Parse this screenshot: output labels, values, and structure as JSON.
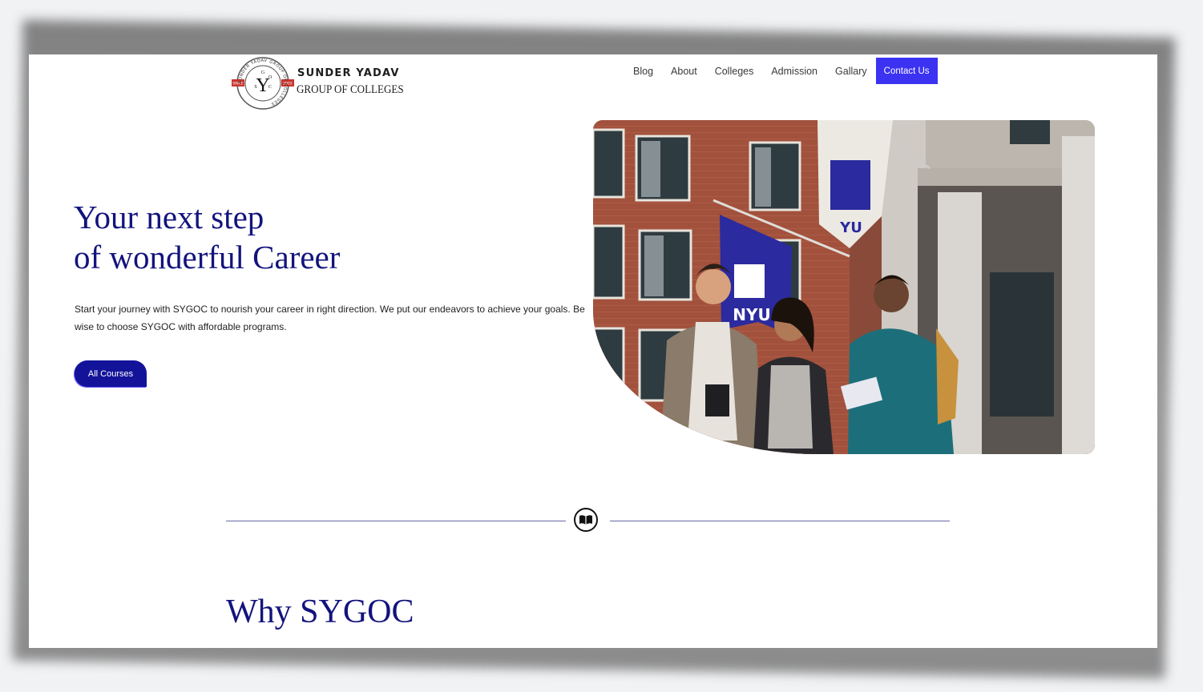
{
  "brand": {
    "logo_ring_text": "SUNDER YADAV GROUP OF COLLEGES",
    "logo_initials": "Y",
    "logo_letters": [
      "S",
      "G",
      "O",
      "C"
    ],
    "logo_since": "SINCE",
    "logo_year": "2002",
    "name": "SUNDER YADAV",
    "subtitle": "GROUP OF COLLEGES"
  },
  "nav": {
    "items": [
      "Blog",
      "About",
      "Colleges",
      "Admission",
      "Gallary"
    ],
    "cta": "Contact Us"
  },
  "hero": {
    "title_line1": "Your next step",
    "title_line2": "of wonderful Career",
    "text": "Start your journey with SYGOC to nourish your career in right direction. We put our endeavors to achieve your goals. Be wise to choose SYGOC with affordable programs.",
    "button": "All Courses",
    "image_flag_text": "NYU",
    "image_flag_text_2": "YU"
  },
  "divider": {
    "icon": "book-icon"
  },
  "section": {
    "title": "Why SYGOC"
  },
  "colors": {
    "primary": "#13137d",
    "button": "#13139a",
    "cta": "#3b32f2",
    "divider": "#6a6aa8"
  }
}
